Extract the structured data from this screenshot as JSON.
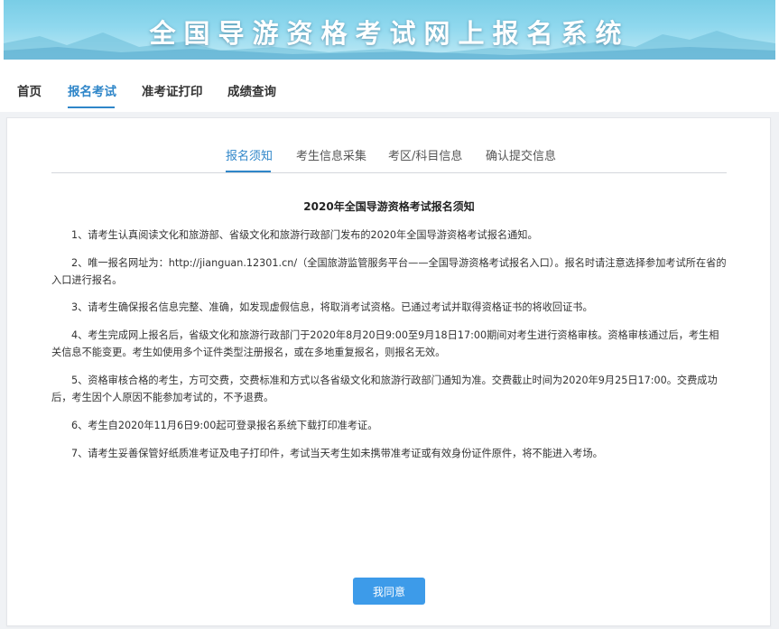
{
  "header": {
    "title": "全国导游资格考试网上报名系统"
  },
  "nav": {
    "items": [
      {
        "label": "首页",
        "active": false
      },
      {
        "label": "报名考试",
        "active": true
      },
      {
        "label": "准考证打印",
        "active": false
      },
      {
        "label": "成绩查询",
        "active": false
      }
    ]
  },
  "steps": {
    "tabs": [
      {
        "label": "报名须知",
        "active": true
      },
      {
        "label": "考生信息采集",
        "active": false
      },
      {
        "label": "考区/科目信息",
        "active": false
      },
      {
        "label": "确认提交信息",
        "active": false
      }
    ]
  },
  "notice": {
    "title": "2020年全国导游资格考试报名须知",
    "paragraphs": [
      "1、请考生认真阅读文化和旅游部、省级文化和旅游行政部门发布的2020年全国导游资格考试报名通知。",
      "2、唯一报名网址为：http://jianguan.12301.cn/（全国旅游监管服务平台——全国导游资格考试报名入口）。报名时请注意选择参加考试所在省的入口进行报名。",
      "3、请考生确保报名信息完整、准确，如发现虚假信息，将取消考试资格。已通过考试并取得资格证书的将收回证书。",
      "4、考生完成网上报名后，省级文化和旅游行政部门于2020年8月20日9:00至9月18日17:00期间对考生进行资格审核。资格审核通过后，考生相关信息不能变更。考生如使用多个证件类型注册报名，或在多地重复报名，则报名无效。",
      "5、资格审核合格的考生，方可交费，交费标准和方式以各省级文化和旅游行政部门通知为准。交费截止时间为2020年9月25日17:00。交费成功后，考生因个人原因不能参加考试的，不予退费。",
      "6、考生自2020年11月6日9:00起可登录报名系统下载打印准考证。",
      "7、请考生妥善保管好纸质准考证及电子打印件，考试当天考生如未携带准考证或有效身份证件原件，将不能进入考场。"
    ]
  },
  "actions": {
    "agree_label": "我同意"
  },
  "colors": {
    "accent": "#2f86c9",
    "button": "#3d9be9",
    "banner": "#8fd8ee"
  }
}
